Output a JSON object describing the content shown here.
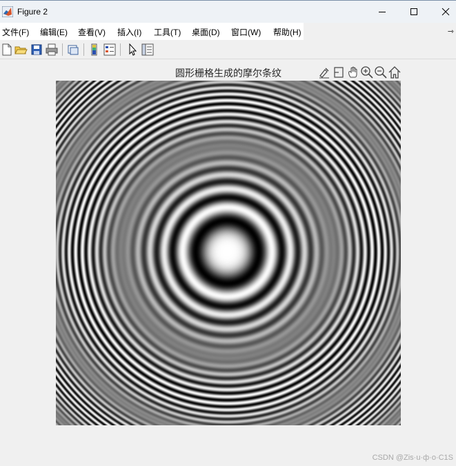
{
  "window": {
    "title": "Figure 2"
  },
  "menu": {
    "items": [
      {
        "label": "文件(F)"
      },
      {
        "label": "编辑(E)"
      },
      {
        "label": "查看(V)"
      },
      {
        "label": "插入(I)"
      },
      {
        "label": "工具(T)"
      },
      {
        "label": "桌面(D)"
      },
      {
        "label": "窗口(W)"
      },
      {
        "label": "帮助(H)"
      }
    ],
    "overflow": "⇾"
  },
  "toolbar": {
    "buttons": [
      "new-figure-icon",
      "open-icon",
      "save-icon",
      "print-icon",
      "link-plot-icon",
      "insert-colorbar-icon",
      "insert-legend-icon",
      "edit-plot-icon",
      "property-inspector-icon"
    ]
  },
  "axes_toolbar": {
    "buttons": [
      "brush-icon",
      "data-tips-icon",
      "pan-icon",
      "zoom-in-icon",
      "zoom-out-icon",
      "home-icon"
    ]
  },
  "plot": {
    "title": "圆形栅格生成的摩尔条纹",
    "type": "image",
    "colormap": "gray"
  },
  "watermark": "CSDN @Zis·u·ф·o·C1S"
}
